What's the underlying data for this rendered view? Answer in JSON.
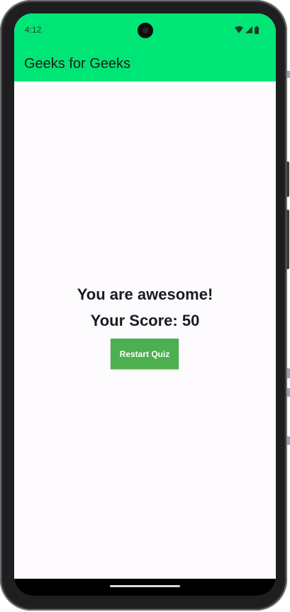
{
  "status_bar": {
    "time": "4:12",
    "icons": [
      "wifi-icon",
      "signal-icon",
      "battery-icon"
    ]
  },
  "app_bar": {
    "title": "Geeks for Geeks",
    "color": "#00E676"
  },
  "quiz_result": {
    "message": "You are awesome!",
    "score_text": "Your Score: 50",
    "restart_label": "Restart Quiz",
    "button_color": "#4CAF50"
  },
  "navigation": {
    "gesture_handle": "home-handle"
  }
}
